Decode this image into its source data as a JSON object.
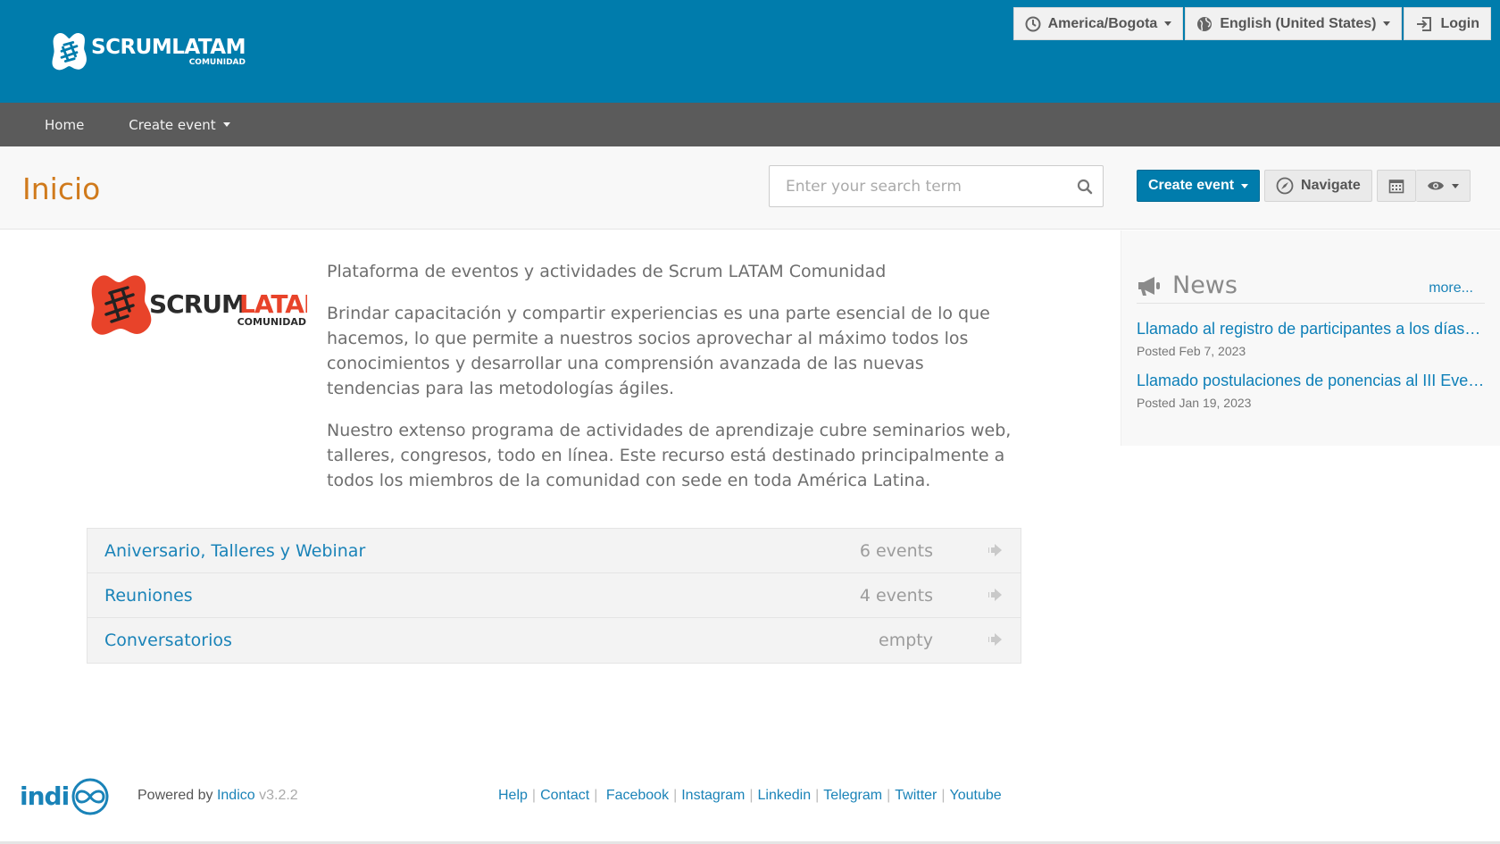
{
  "header": {
    "logo_text": "SCRUMLATAM",
    "logo_subtext": "COMUNIDAD",
    "timezone_label": "America/Bogota",
    "language_label": "English (United States)",
    "login_label": "Login"
  },
  "nav": {
    "home": "Home",
    "create_event": "Create event"
  },
  "title_bar": {
    "page_title": "Inicio",
    "search_placeholder": "Enter your search term",
    "create_event_btn": "Create event",
    "navigate_btn": "Navigate"
  },
  "main": {
    "content_logo_text": "SCRUMLATAM",
    "content_logo_subtext": "COMUNIDAD",
    "paragraphs": [
      "Plataforma de eventos y actividades de Scrum LATAM Comunidad",
      "Brindar capacitación y compartir experiencias es una parte esencial de lo que hacemos, lo que permite a nuestros socios aprovechar al máximo todos los conocimientos y desarrollar una comprensión avanzada de las nuevas tendencias para las metodologías ágiles.",
      "Nuestro extenso programa de actividades de aprendizaje cubre seminarios web, talleres, congresos, todo en línea. Este recurso está destinado principalmente a todos los miembros de la comunidad con sede en toda América Latina."
    ],
    "categories": [
      {
        "title": "Aniversario, Talleres y Webinar",
        "count": "6 events"
      },
      {
        "title": "Reuniones",
        "count": "4 events"
      },
      {
        "title": "Conversatorios",
        "count": "empty"
      }
    ]
  },
  "news": {
    "title": "News",
    "more": "more...",
    "items": [
      {
        "title": "Llamado al registro de participantes a los días de la agilidad",
        "date": "Posted Feb 7, 2023"
      },
      {
        "title": "Llamado postulaciones de ponencias al III Evento",
        "date": "Posted Jan 19, 2023"
      }
    ]
  },
  "footer": {
    "indico_logo": "indico",
    "powered_by": "Powered by",
    "indico_link": "Indico",
    "version": "v3.2.2",
    "links": [
      "Help",
      "Contact",
      "Facebook",
      "Instagram",
      "Linkedin",
      "Telegram",
      "Twitter",
      "Youtube"
    ]
  },
  "colors": {
    "header_blue": "#007cac",
    "nav_gray": "#5b5b5b",
    "title_orange": "#d07a1c",
    "link_blue": "#1a83b8",
    "logo_red": "#e8432a"
  },
  "icons": [
    "clock-icon",
    "globe-icon",
    "login-icon",
    "search-icon",
    "compass-icon",
    "calendar-icon",
    "eye-icon",
    "megaphone-icon",
    "arrow-right-icon"
  ]
}
